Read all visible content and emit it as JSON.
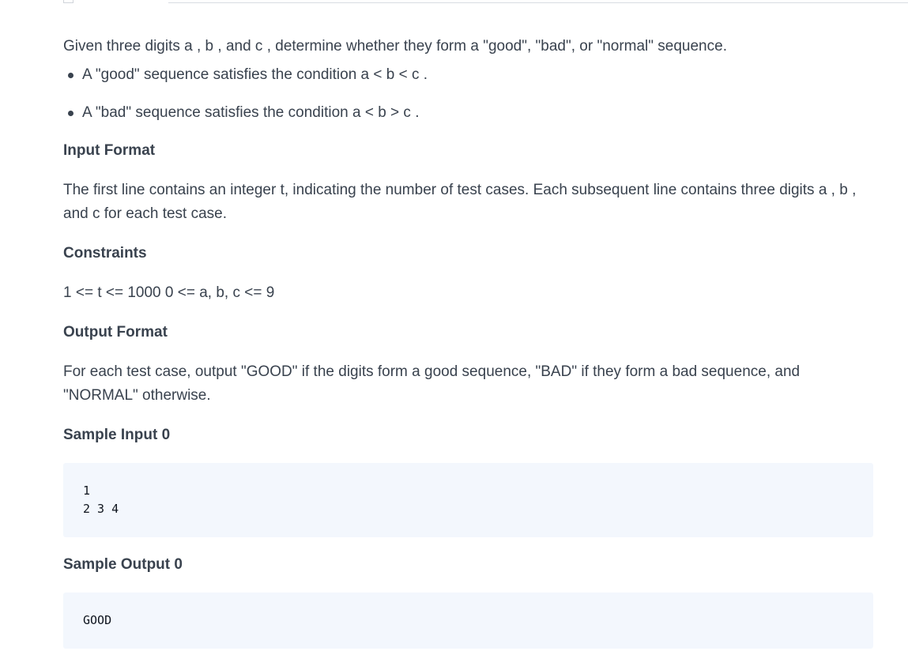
{
  "intro": "Given three digits a , b , and c , determine whether they form a \"good\", \"bad\", or \"normal\" sequence.",
  "bullets": [
    "A \"good\" sequence satisfies the condition a < b < c .",
    "A \"bad\" sequence satisfies the condition a < b > c ."
  ],
  "input_format": {
    "heading": "Input Format",
    "text": "The first line contains an integer t, indicating the number of test cases. Each subsequent line contains three digits a , b , and c for each test case."
  },
  "constraints": {
    "heading": "Constraints",
    "text": "1 <= t <= 1000 0 <= a, b, c <= 9"
  },
  "output_format": {
    "heading": "Output Format",
    "text": "For each test case, output \"GOOD\" if the digits form a good sequence, \"BAD\" if they form a bad sequence, and \"NORMAL\" otherwise."
  },
  "sample_input": {
    "heading": "Sample Input 0",
    "code": "1\n2 3 4"
  },
  "sample_output": {
    "heading": "Sample Output 0",
    "code": "GOOD"
  }
}
